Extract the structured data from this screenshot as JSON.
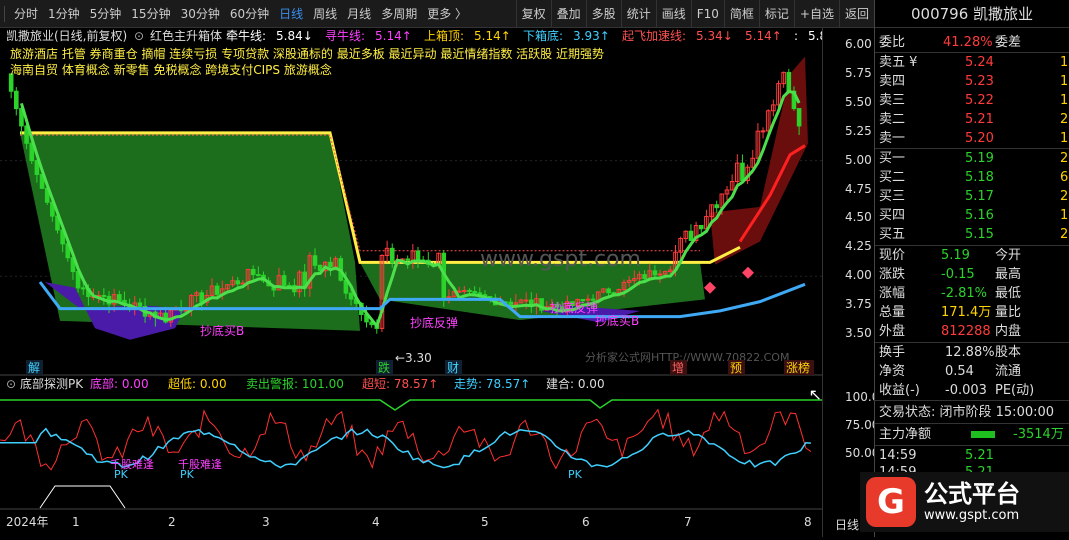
{
  "toolbar": {
    "tabs": [
      "分时",
      "1分钟",
      "5分钟",
      "15分钟",
      "30分钟",
      "60分钟",
      "日线",
      "周线",
      "月线",
      "多周期",
      "更多 〉"
    ],
    "active_tab": "日线",
    "buttons": [
      "复权",
      "叠加",
      "多股",
      "统计",
      "画线",
      "F10",
      "简框",
      "标记",
      "+自选",
      "返回"
    ]
  },
  "chart_header": {
    "stock": "凯撒旅业(日线,前复权)",
    "indicator": "红色主升箱体",
    "items": [
      {
        "label": "牵牛线:",
        "value": "5.84↓",
        "color": "#ffffff"
      },
      {
        "label": "寻牛线:",
        "value": "5.14↑",
        "color": "#ff40ff"
      },
      {
        "label": "上箱顶:",
        "value": "5.14↑",
        "color": "#ffd200"
      },
      {
        "label": "下箱底:",
        "value": "3.93↑",
        "color": "#3fd0ff"
      },
      {
        "label": "起飞加速线:",
        "value": "5.34↓",
        "color": "#ff5050"
      },
      {
        "label": "",
        "value": "5.14↑",
        "color": "#ff5050"
      },
      {
        "label": ":",
        "value": "5.84↓",
        "color": "#ffffff"
      },
      {
        "label": ":",
        "value": "5.84↓",
        "color": "#ffffff"
      }
    ],
    "concepts_line1": "旅游酒店 托管 券商重仓 摘帽 连续亏损 专项贷款 深股通标的 最近多板 最近异动 最近情绪指数 活跃股 近期强势",
    "concepts_line2": "海南自贸 体育概念 新零售 免税概念 跨境支付CIPS 旅游概念"
  },
  "chart_annotations": {
    "low_price": "3.30",
    "watermark_url": "www.gspt.com",
    "watermark_credit": "分析家公式网HTTP://WWW.70822.COM",
    "labels_buy": [
      "抄底买B",
      "抄底反弹",
      "抄底反弹",
      "抄底买B"
    ],
    "event_markers": [
      "解",
      "跌",
      "财",
      "增",
      "预",
      "涨榜"
    ]
  },
  "price_axis": [
    "6.00",
    "5.75",
    "5.50",
    "5.25",
    "5.00",
    "4.75",
    "4.50",
    "4.25",
    "4.00",
    "3.75",
    "3.50"
  ],
  "sub_header": {
    "name": "底部探测PK",
    "items": [
      {
        "label": "底部:",
        "value": "0.00",
        "color": "#ff40ff"
      },
      {
        "label": "超低:",
        "value": "0.00",
        "color": "#ffd200"
      },
      {
        "label": "卖出警报:",
        "value": "101.00",
        "color": "#2bd32b"
      },
      {
        "label": "超短:",
        "value": "78.57↑",
        "color": "#ff5050"
      },
      {
        "label": "走势:",
        "value": "78.57↑",
        "color": "#3fd0ff"
      },
      {
        "label": "建合:",
        "value": "0.00",
        "color": "#dddddd"
      }
    ],
    "labels": [
      "千股难逢",
      "千股难逢",
      "PK",
      "PK",
      "PK"
    ]
  },
  "sub_axis": [
    "100.0",
    "75.00",
    "50.00"
  ],
  "date_axis": [
    "2024年",
    "1",
    "2",
    "3",
    "4",
    "5",
    "6",
    "7",
    "8"
  ],
  "date_axis_btn": "日线",
  "quote": {
    "code_name": "000796 凯撒旅业",
    "weibi_label": "委比",
    "weibi_value": "41.28%",
    "weicha_label": "委差",
    "asks": [
      {
        "label": "卖五 ¥",
        "price": "5.24",
        "vol": "1"
      },
      {
        "label": "卖四",
        "price": "5.23",
        "vol": "1"
      },
      {
        "label": "卖三",
        "price": "5.22",
        "vol": "1"
      },
      {
        "label": "卖二",
        "price": "5.21",
        "vol": "2"
      },
      {
        "label": "卖一",
        "price": "5.20",
        "vol": "1"
      }
    ],
    "bids": [
      {
        "label": "买一",
        "price": "5.19",
        "vol": "2"
      },
      {
        "label": "买二",
        "price": "5.18",
        "vol": "6"
      },
      {
        "label": "买三",
        "price": "5.17",
        "vol": "2"
      },
      {
        "label": "买四",
        "price": "5.16",
        "vol": "1"
      },
      {
        "label": "买五",
        "price": "5.15",
        "vol": "2"
      }
    ],
    "stats": [
      {
        "l1": "现价",
        "v1": "5.19",
        "c1": "green",
        "l2": "今开"
      },
      {
        "l1": "涨跌",
        "v1": "-0.15",
        "c1": "green",
        "l2": "最高"
      },
      {
        "l1": "涨幅",
        "v1": "-2.81%",
        "c1": "green",
        "l2": "最低"
      },
      {
        "l1": "总量",
        "v1": "171.4万",
        "c1": "yellow",
        "l2": "量比"
      },
      {
        "l1": "外盘",
        "v1": "812288",
        "c1": "red",
        "l2": "内盘"
      }
    ],
    "stats2": [
      {
        "l1": "换手",
        "v1": "12.88%",
        "c1": "white",
        "l2": "股本"
      },
      {
        "l1": "净资",
        "v1": "0.54",
        "c1": "white",
        "l2": "流通"
      },
      {
        "l1": "收益(-)",
        "v1": "-0.003",
        "c1": "white",
        "l2": "PE(动)"
      }
    ],
    "trade_status": "交易状态: 闭市阶段 15:00:00",
    "main_net_label": "主力净额",
    "main_net_value": "-3514万",
    "ticks": [
      {
        "time": "14:59",
        "price": "5.21"
      },
      {
        "time": "14:59",
        "price": "5.21"
      }
    ]
  },
  "brand": {
    "mark": "G",
    "name": "公式平台",
    "url": "www.gspt.com"
  },
  "colors": {
    "up": "#ff3b3b",
    "down": "#2bd32b",
    "box": "#1f7a1f",
    "cyan_line": "#3fa9f5",
    "yellow_line": "#ffee44",
    "accent": "#3a8ff0"
  }
}
